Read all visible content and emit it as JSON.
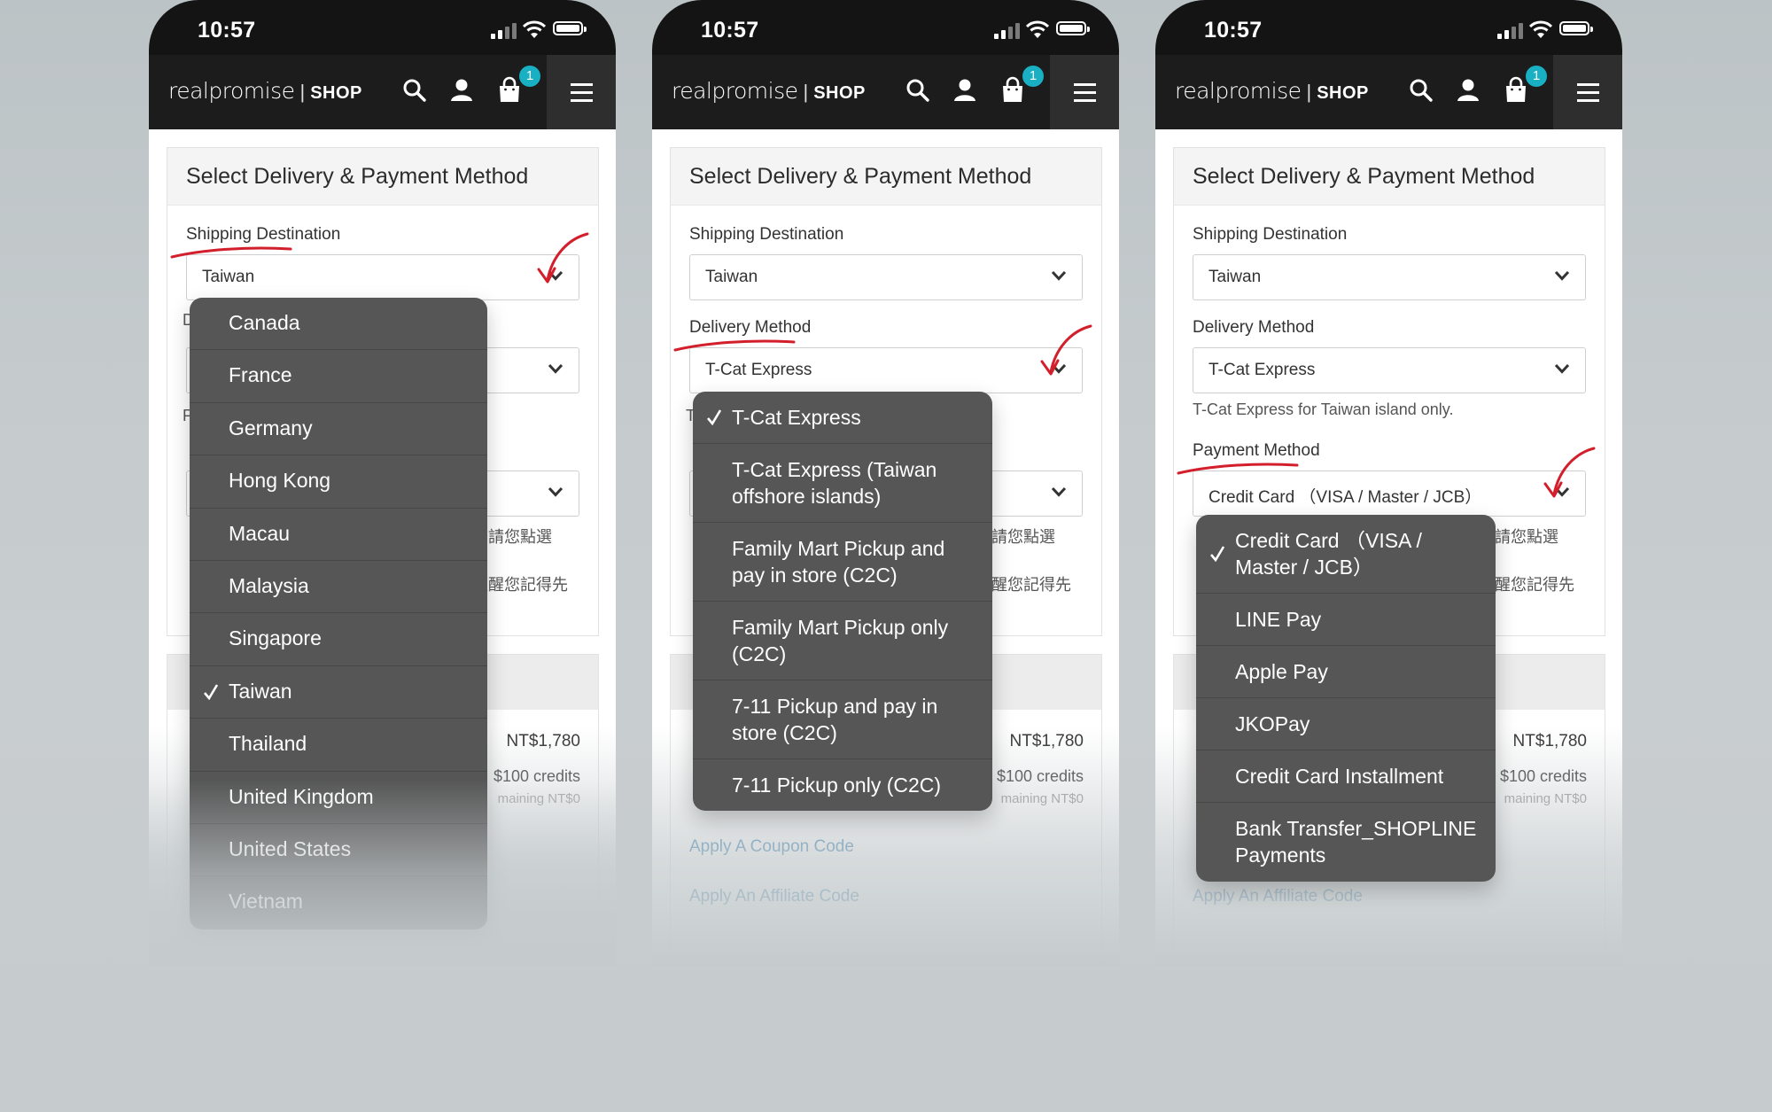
{
  "common": {
    "time": "10:57",
    "brand_name": "realpromise",
    "brand_sep": "|",
    "brand_shop": "SHOP",
    "cart_count": "1",
    "card_title": "Select Delivery & Payment Method",
    "shipping_label": "Shipping Destination",
    "shipping_value": "Taiwan",
    "delivery_label": "Delivery Method",
    "delivery_value": "T-Cat Express",
    "delivery_note": "T-Cat Express for Taiwan island only.",
    "payment_label": "Payment Method",
    "payment_value": "Credit Card （VISA / Master / JCB）",
    "partial_text_1": "請您點選",
    "partial_text_2": "提醒您記得先",
    "price": "NT$1,780",
    "credits": "$100 credits",
    "remaining": "maining NT$0",
    "coupon_link": "Apply A Coupon Code",
    "affiliate_link": "Apply An Affiliate Code"
  },
  "dropdowns": {
    "shipping_options": [
      "Canada",
      "France",
      "Germany",
      "Hong Kong",
      "Macau",
      "Malaysia",
      "Singapore",
      "Taiwan",
      "Thailand",
      "United Kingdom",
      "United States",
      "Vietnam"
    ],
    "shipping_selected": "Taiwan",
    "delivery_options": [
      "T-Cat Express",
      "T-Cat Express (Taiwan offshore islands)",
      "Family Mart Pickup and pay in store (C2C)",
      "Family Mart Pickup only (C2C)",
      "7-11 Pickup and pay in store (C2C)",
      "7-11 Pickup only (C2C)"
    ],
    "delivery_selected": "T-Cat Express",
    "payment_options": [
      "Credit Card （VISA / Master / JCB）",
      "LINE Pay",
      "Apple Pay",
      "JKOPay",
      "Credit Card Installment",
      "Bank Transfer_SHOPLINE Payments"
    ],
    "payment_selected": "Credit Card （VISA / Master / JCB）"
  },
  "icons": {
    "search": "search-icon",
    "account": "user-icon",
    "cart": "shopping-bag-icon",
    "menu": "hamburger-menu-icon",
    "dropdown_arrow": "chevron-down-icon",
    "selected": "checkmark-icon",
    "annotation": "red-arrow-annotation"
  },
  "colors": {
    "navbar": "#1c1c1c",
    "badge": "#1ab0c4",
    "dropdown": "#565656",
    "annotation": "#d21f2b",
    "link": "#3f86b4"
  }
}
